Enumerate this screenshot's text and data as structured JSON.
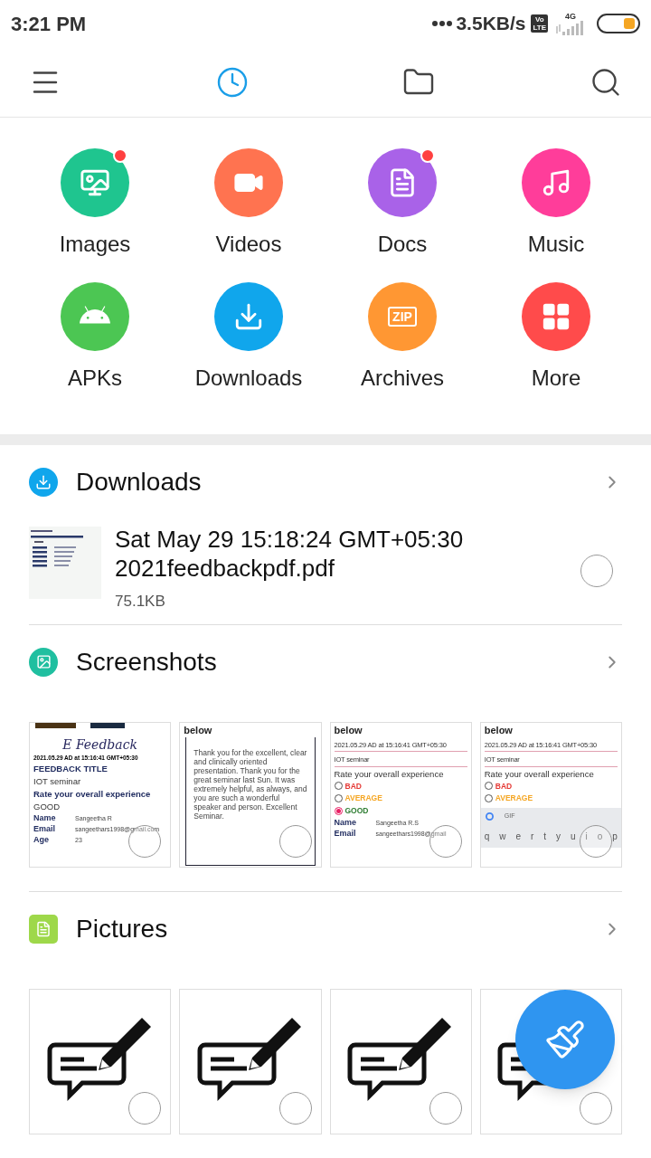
{
  "status_bar": {
    "time": "3:21 PM",
    "speed": "3.5KB/s",
    "volte": [
      "Vo",
      "LTE"
    ],
    "network": "4G"
  },
  "toolbar": [
    {
      "kind": "menu",
      "selected": false
    },
    {
      "kind": "recent",
      "selected": true
    },
    {
      "kind": "folder",
      "selected": false
    },
    {
      "kind": "search",
      "selected": false
    }
  ],
  "categories": [
    {
      "kind": "images",
      "label": "Images",
      "color": "#1fc58f",
      "badge": true
    },
    {
      "kind": "videos",
      "label": "Videos",
      "color": "#ff7350",
      "badge": false
    },
    {
      "kind": "docs",
      "label": "Docs",
      "color": "#a962e8",
      "badge": true
    },
    {
      "kind": "music",
      "label": "Music",
      "color": "#ff3d9a",
      "badge": false
    },
    {
      "kind": "apks",
      "label": "APKs",
      "color": "#4cc653",
      "badge": false
    },
    {
      "kind": "downloads",
      "label": "Downloads",
      "color": "#10a6ec",
      "badge": false
    },
    {
      "kind": "archives",
      "label": "Archives",
      "color": "#ff9733",
      "badge": false,
      "icon_text": "ZIP"
    },
    {
      "kind": "more",
      "label": "More",
      "color": "#ff4b4b",
      "badge": false
    }
  ],
  "sections": [
    {
      "kind": "downloads",
      "title": "Downloads",
      "files": [
        {
          "name": "Sat May 29 15:18:24 GMT+05:30 2021feedbackpdf.pdf",
          "size": "75.1KB",
          "selected": false
        }
      ]
    },
    {
      "kind": "screenshots",
      "title": "Screenshots",
      "thumbnails": [
        {
          "selected": false,
          "bars": true,
          "lines": [
            {
              "kind": "title",
              "text": "E Feedback"
            },
            {
              "kind": "date",
              "text": "2021.05.29 AD at 15:16:41 GMT+05:30"
            },
            {
              "kind": "heading",
              "text": "FEEDBACK TITLE"
            },
            {
              "kind": "text",
              "text": "IOT seminar"
            },
            {
              "kind": "heading",
              "text": "Rate your overall experience"
            },
            {
              "kind": "text",
              "text": "GOOD"
            },
            {
              "kind": "field",
              "label": "Name",
              "text": "Sangeetha R"
            },
            {
              "kind": "field",
              "label": "Email",
              "text": "sangeethars1998@gmail.com"
            },
            {
              "kind": "field",
              "label": "Age",
              "text": "23"
            }
          ]
        },
        {
          "selected": false,
          "header": "below",
          "lines": [
            {
              "kind": "paragraph",
              "text": "Thank you for the excellent, clear and clinically oriented presentation. Thank you for the great seminar last Sun. It was extremely helpful, as always, and you are such a wonderful speaker and person. Excellent Seminar."
            }
          ]
        },
        {
          "selected": false,
          "header": "below",
          "lines": [
            {
              "kind": "input",
              "text": "2021.05.29 AD at 15:16:41 GMT+05:30"
            },
            {
              "kind": "input",
              "text": "IOT seminar"
            },
            {
              "kind": "text",
              "text": "Rate your overall experience"
            },
            {
              "kind": "radio",
              "text": "BAD",
              "color": "#e53935",
              "selected": false
            },
            {
              "kind": "radio",
              "text": "AVERAGE",
              "color": "#f5a623",
              "selected": false
            },
            {
              "kind": "radio",
              "text": "GOOD",
              "color": "#2e7d32",
              "selected": true
            },
            {
              "kind": "field",
              "label": "Name",
              "text": "Sangeetha R.S"
            },
            {
              "kind": "field",
              "label": "Email",
              "text": "sangeethars1998@gmail"
            }
          ]
        },
        {
          "selected": false,
          "header": "below",
          "lines": [
            {
              "kind": "input",
              "text": "2021.05.29 AD at 15:16:41 GMT+05:30"
            },
            {
              "kind": "input",
              "text": "IOT seminar"
            },
            {
              "kind": "text",
              "text": "Rate your overall experience"
            },
            {
              "kind": "radio",
              "text": "BAD",
              "color": "#e53935",
              "selected": false
            },
            {
              "kind": "radio",
              "text": "AVERAGE",
              "color": "#f5a623",
              "selected": false
            },
            {
              "kind": "kb_toolbar",
              "text": "GIF"
            },
            {
              "kind": "keys",
              "keys": [
                "q",
                "w",
                "e",
                "r",
                "t",
                "y",
                "u",
                "i",
                "o",
                "p"
              ]
            }
          ]
        }
      ]
    },
    {
      "kind": "pictures",
      "title": "Pictures",
      "pictures": [
        {
          "selected": false
        },
        {
          "selected": false
        },
        {
          "selected": false
        },
        {
          "selected": false
        }
      ]
    }
  ]
}
